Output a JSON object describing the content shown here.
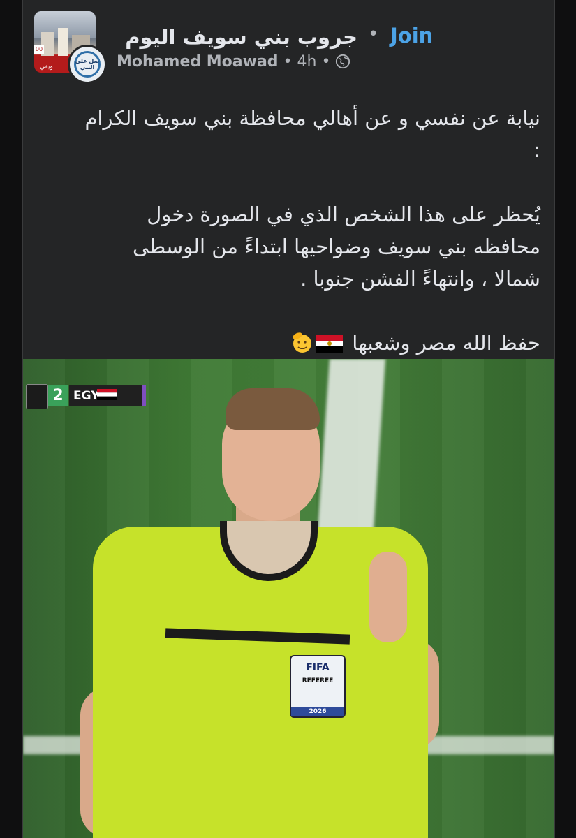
{
  "header": {
    "group_name": "جروب بني سويف اليوم",
    "join_label": "Join",
    "author": "Mohamed Moawad",
    "time": "4h",
    "privacy_icon": "globe-icon",
    "group_thumb_badge": "00",
    "group_thumb_strip": "ويفي",
    "avatar_text": "صل على النبي"
  },
  "post": {
    "line1": "نيابة عن نفسي و عن أهالي محافظة بني سويف الكرام",
    "line2": ":",
    "line3": "يُحظر على هذا الشخص الذي في الصورة دخول",
    "line4": "محافظه بني سويف وضواحيها ابتداءً من الوسطى",
    "line5": "شمالا ، وانتهاءً الفشن جنوبا .",
    "line6": "حفظ الله مصر وشعبها",
    "flag_icon": "egypt-flag-icon",
    "emoji_icon": "saluting-face-icon"
  },
  "photo": {
    "scorebug_score": "2",
    "scorebug_team": "EGY",
    "badge_title": "FIFA",
    "badge_sub": "REFEREE",
    "badge_year": "2026"
  },
  "colors": {
    "accent": "#4ca3e6",
    "card_bg": "#242526",
    "text": "#e4e6eb",
    "muted": "#b0b3b8"
  }
}
